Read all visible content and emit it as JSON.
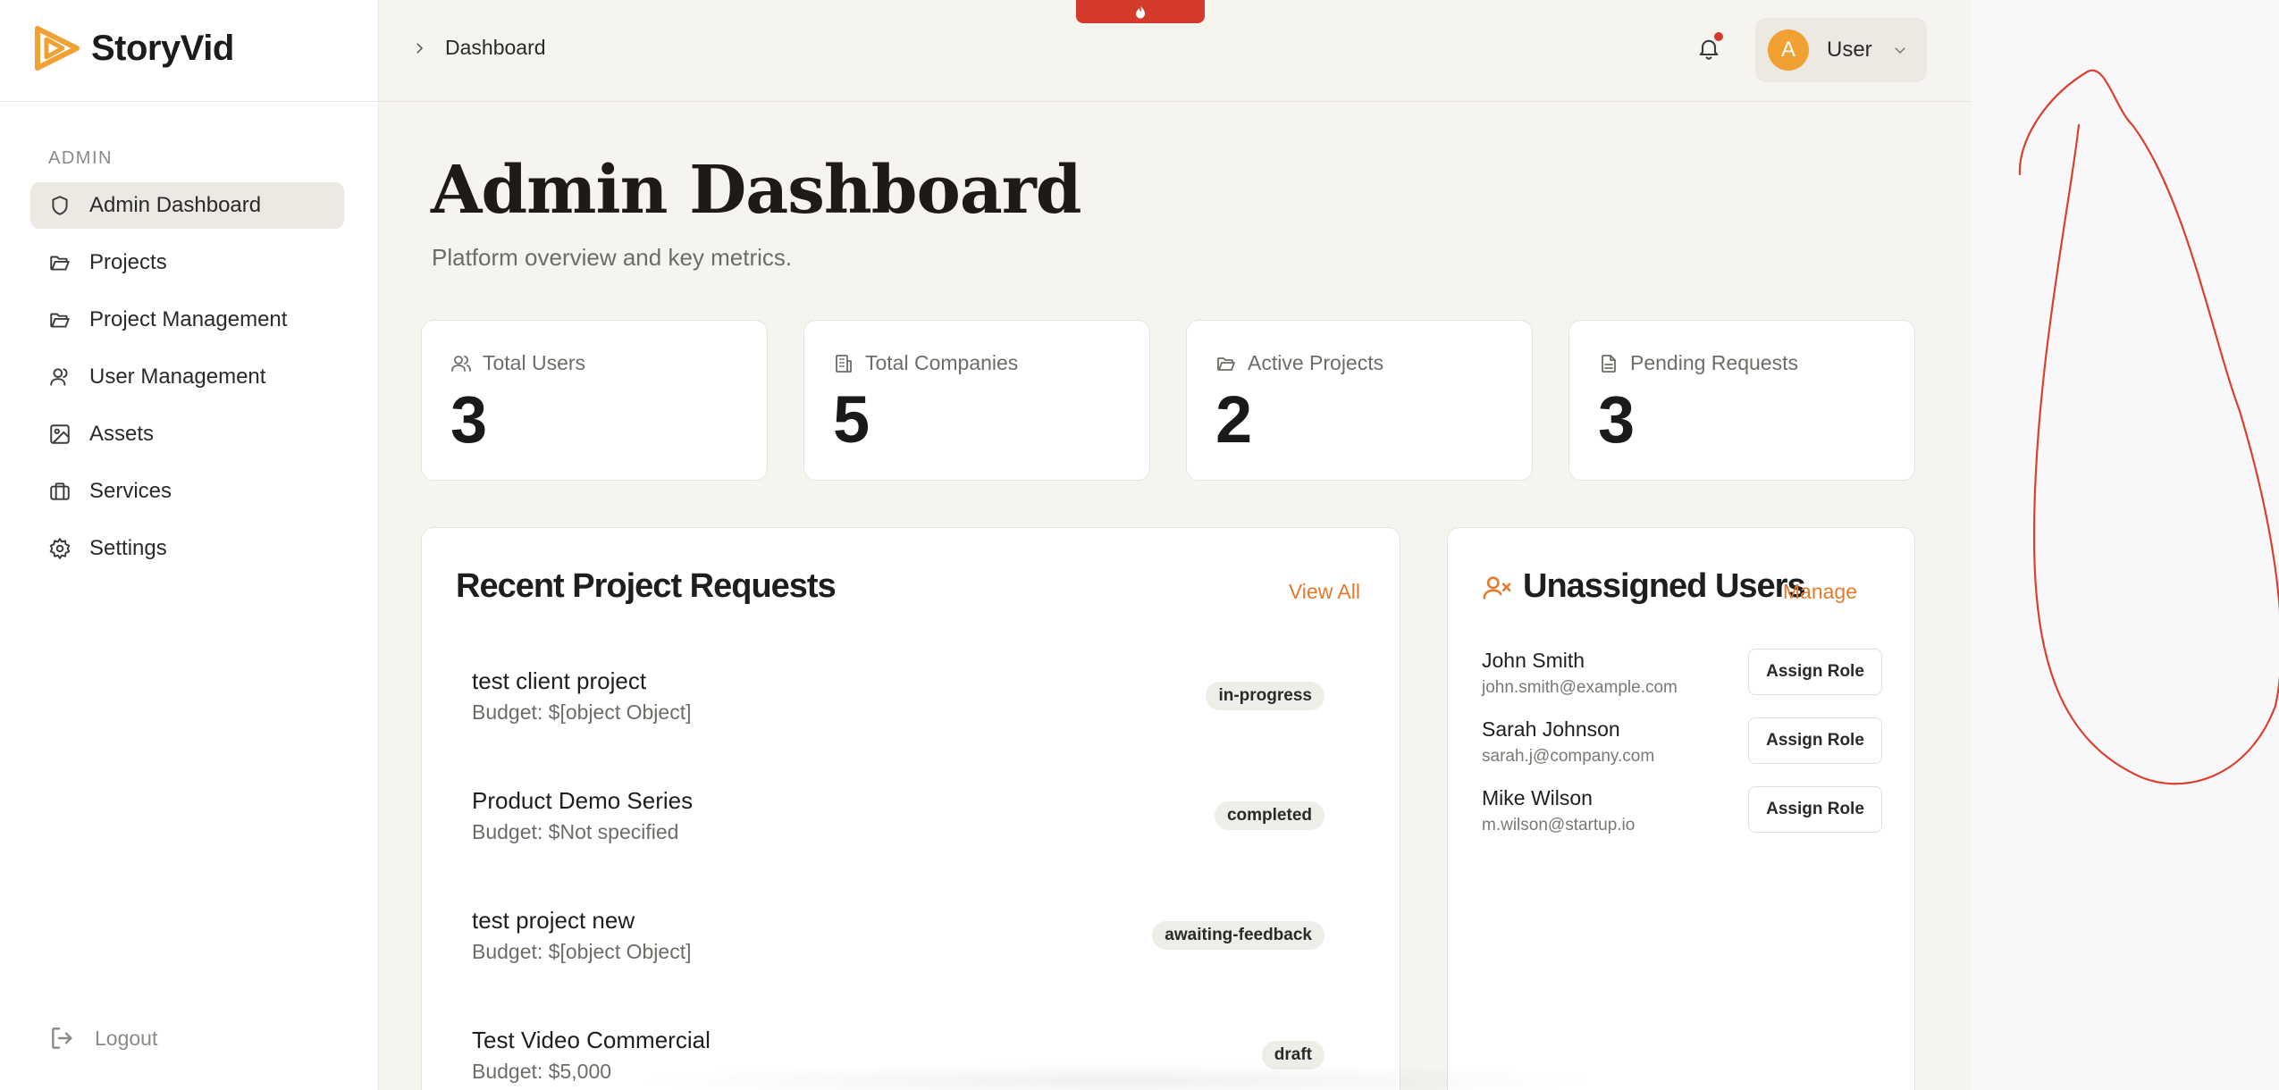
{
  "app": {
    "name": "StoryVid",
    "brand_color": "#f0a132",
    "accent_color": "#e47a2c",
    "alert_color": "#d43a2a"
  },
  "sidebar": {
    "section_label": "ADMIN",
    "items": [
      {
        "label": "Admin Dashboard",
        "icon": "shield-icon",
        "active": true
      },
      {
        "label": "Projects",
        "icon": "folder-icon",
        "active": false
      },
      {
        "label": "Project Management",
        "icon": "folder-icon",
        "active": false
      },
      {
        "label": "User Management",
        "icon": "user-icon",
        "active": false
      },
      {
        "label": "Assets",
        "icon": "image-icon",
        "active": false
      },
      {
        "label": "Services",
        "icon": "briefcase-icon",
        "active": false
      },
      {
        "label": "Settings",
        "icon": "gear-icon",
        "active": false
      }
    ],
    "logout_label": "Logout"
  },
  "header": {
    "breadcrumb": "Dashboard",
    "user_initial": "A",
    "user_name": "User",
    "notification_dot": true
  },
  "page": {
    "title": "Admin Dashboard",
    "subtitle": "Platform overview and key metrics."
  },
  "stats": [
    {
      "label": "Total Users",
      "value": "3",
      "icon": "users-icon"
    },
    {
      "label": "Total Companies",
      "value": "5",
      "icon": "building-icon"
    },
    {
      "label": "Active Projects",
      "value": "2",
      "icon": "folder-open-icon"
    },
    {
      "label": "Pending Requests",
      "value": "3",
      "icon": "file-icon"
    }
  ],
  "recent_requests": {
    "title": "Recent Project Requests",
    "link_label": "View All",
    "rows": [
      {
        "name": "test client project",
        "budget": "Budget: $[object Object]",
        "status": "in-progress"
      },
      {
        "name": "Product Demo Series",
        "budget": "Budget: $Not specified",
        "status": "completed"
      },
      {
        "name": "test project new",
        "budget": "Budget: $[object Object]",
        "status": "awaiting-feedback"
      },
      {
        "name": "Test Video Commercial",
        "budget": "Budget: $5,000",
        "status": "draft"
      }
    ]
  },
  "unassigned_users": {
    "title": "Unassigned Users",
    "link_label": "Manage",
    "icon": "user-x-icon",
    "button_label": "Assign Role",
    "rows": [
      {
        "name": "John Smith",
        "email": "john.smith@example.com"
      },
      {
        "name": "Sarah Johnson",
        "email": "sarah.j@company.com"
      },
      {
        "name": "Mike Wilson",
        "email": "m.wilson@startup.io"
      }
    ]
  }
}
